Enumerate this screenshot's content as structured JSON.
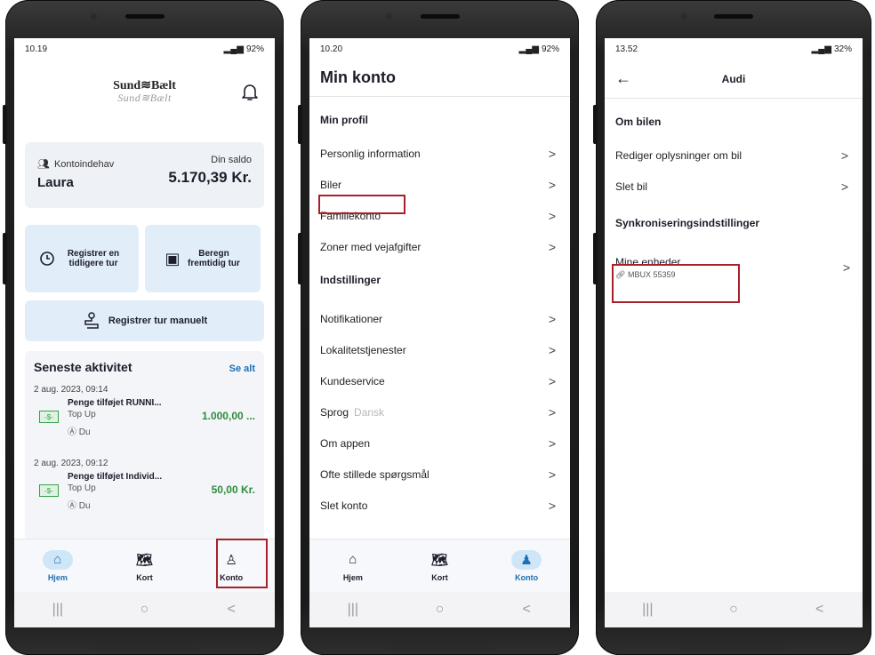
{
  "colors": {
    "accent": "#1e6fb3",
    "highlight": "#a8202a",
    "positive": "#2e8b3d",
    "card": "#eef1f5",
    "tile": "#e1eef9"
  },
  "phone1": {
    "status": {
      "time": "10.19",
      "battery": "92%"
    },
    "logo": {
      "main": "Sund≋Bælt",
      "ghost": "Sund≋Bælt"
    },
    "account": {
      "label": "Kontoindehav",
      "name": "Laura",
      "saldo_label": "Din saldo",
      "saldo_value": "5.170,39 Kr."
    },
    "quick": [
      {
        "label": "Registrer en tidligere tur",
        "icon": "clock-icon"
      },
      {
        "label": "Beregn fremtidig tur",
        "icon": "calculator-icon"
      }
    ],
    "manual": {
      "label": "Registrer tur manuelt",
      "icon": "route-icon"
    },
    "activity": {
      "title": "Seneste aktivitet",
      "see_all": "Se alt",
      "items": [
        {
          "date": "2 aug. 2023, 09:14",
          "name": "Penge tilføjet RUNNI...",
          "type": "Top Up",
          "who": "Du",
          "amount": "1.000,00 ..."
        },
        {
          "date": "2 aug. 2023, 09:12",
          "name": "Penge tilføjet Individ...",
          "type": "Top Up",
          "who": "Du",
          "amount": "50,00 Kr."
        }
      ]
    },
    "tabs": [
      {
        "label": "Hjem",
        "active": true
      },
      {
        "label": "Kort"
      },
      {
        "label": "Konto"
      }
    ]
  },
  "phone2": {
    "status": {
      "time": "10.20",
      "battery": "92%"
    },
    "title": "Min konto",
    "profile_section": "Min profil",
    "profile_items": [
      "Personlig information",
      "Biler",
      "Familiekonto",
      "Zoner med vejafgifter"
    ],
    "settings_section": "Indstillinger",
    "settings_items": [
      "Notifikationer",
      "Lokalitetstjenester",
      "Kundeservice",
      "Sprog",
      "Om appen",
      "Ofte stillede spørgsmål",
      "Slet konto"
    ],
    "language_value": "Dansk",
    "tabs": [
      {
        "label": "Hjem"
      },
      {
        "label": "Kort"
      },
      {
        "label": "Konto",
        "active": true
      }
    ]
  },
  "phone3": {
    "status": {
      "time": "13.52",
      "battery": "32%"
    },
    "title": "Audi",
    "section1": "Om bilen",
    "items": [
      "Rediger oplysninger om bil",
      "Slet bil"
    ],
    "section2": "Synkroniseringsindstillinger",
    "device": {
      "name": "Mine enheder",
      "id": "MBUX 55359"
    }
  },
  "nav": {
    "recent": "|||",
    "home": "○",
    "back": "<"
  },
  "chevron": ">"
}
